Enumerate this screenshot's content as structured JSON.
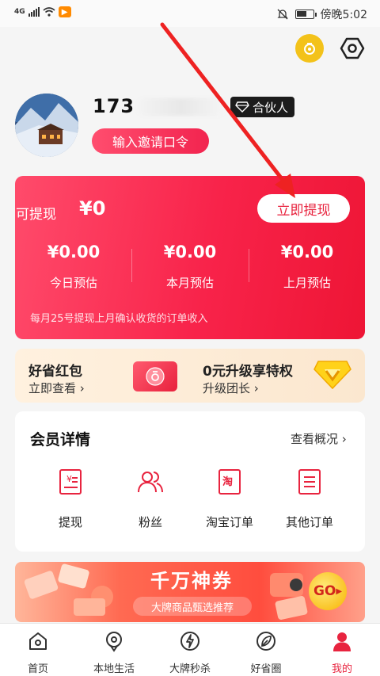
{
  "status_bar": {
    "network": "4G",
    "time": "傍晚5:02",
    "app_badge": "▶"
  },
  "profile": {
    "phone": "173",
    "badge": "合伙人",
    "invite_button": "输入邀请口令"
  },
  "wallet": {
    "withdrawable_label": "可提现",
    "withdrawable_amount": "¥0",
    "withdraw_button": "立即提现",
    "stats": [
      {
        "value": "¥0.00",
        "label": "今日预估"
      },
      {
        "value": "¥0.00",
        "label": "本月预估"
      },
      {
        "value": "¥0.00",
        "label": "上月预估"
      }
    ],
    "note": "每月25号提现上月确认收货的订单收入"
  },
  "promo": {
    "left_title": "好省红包",
    "left_sub": "立即查看",
    "right_title": "0元升级享特权",
    "right_sub": "升级团长"
  },
  "member": {
    "title": "会员详情",
    "more": "查看概况",
    "items": [
      {
        "label": "提现",
        "icon": "yen-doc-icon"
      },
      {
        "label": "粉丝",
        "icon": "fans-icon"
      },
      {
        "label": "淘宝订单",
        "icon": "taobao-order-icon"
      },
      {
        "label": "其他订单",
        "icon": "other-order-icon"
      }
    ]
  },
  "banner": {
    "title": "千万神券",
    "subtitle": "大牌商品甄选推荐",
    "go": "GO"
  },
  "tabbar": {
    "items": [
      {
        "label": "首页",
        "icon": "home-icon"
      },
      {
        "label": "本地生活",
        "icon": "location-icon"
      },
      {
        "label": "大牌秒杀",
        "icon": "flash-icon"
      },
      {
        "label": "好省圈",
        "icon": "leaf-icon"
      },
      {
        "label": "我的",
        "icon": "person-icon"
      }
    ],
    "active_index": 4
  },
  "colors": {
    "accent": "#e8243f",
    "coin": "#f3c21a",
    "promo_bg": "#fff1df"
  }
}
